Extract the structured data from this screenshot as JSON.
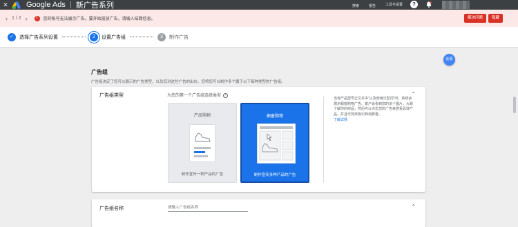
{
  "header": {
    "brand": "Google Ads",
    "title": "新广告系列",
    "tools": [
      {
        "icon": "search-icon",
        "label": "搜索"
      },
      {
        "icon": "report-icon",
        "label": "报告"
      },
      {
        "icon": "tools-icon",
        "label": "工具与设置"
      }
    ]
  },
  "alert": {
    "pager": "1 / 2",
    "message": "您的帐号无法展示广告。要开始投放广告，请输入结算信息。",
    "fix_label": "解决问题",
    "close_label": "隐藏"
  },
  "stepper": {
    "steps": [
      {
        "number": "✓",
        "label": "选择广告系列设置"
      },
      {
        "number": "2",
        "label": "设置广告组"
      },
      {
        "number": "3",
        "label": "制作广告"
      }
    ]
  },
  "section": {
    "title": "广告组",
    "description": "广告组决定了您可以展示的广告类型，以及您对这些广告的出价。您将您可以制作多个属于以下每种类型的广告组。"
  },
  "fab_label": "反馈",
  "ad_group_type": {
    "label": "广告组类型",
    "prompt": "为您的第一个广告组选择类型",
    "options": [
      {
        "title": "产品购物",
        "description": "制作宣传一种产品的广告"
      },
      {
        "title": "橱窗购物",
        "description": "制作宣传多种产品的广告"
      }
    ],
    "help_text": "当有产品型号正文本中“以及使用泛型词”时，系统会展示橱窗购物广告。客户会看到您的多个图片，大致了解你的商品，然后可以点击您的广告来查看具体产品，并且可有效吸引到消费者。",
    "help_link": "了解详情"
  },
  "ad_group_name": {
    "label": "广告组名称",
    "placeholder": "请输入广告组名称"
  }
}
